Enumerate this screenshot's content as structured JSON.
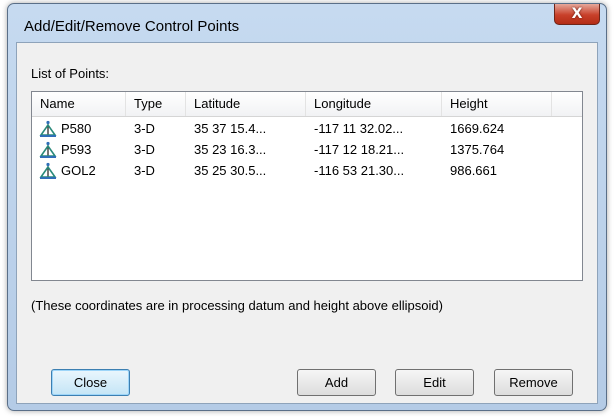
{
  "window": {
    "title": "Add/Edit/Remove Control Points",
    "close_glyph": "X"
  },
  "list": {
    "label": "List of Points:",
    "columns": [
      "Name",
      "Type",
      "Latitude",
      "Longitude",
      "Height"
    ],
    "rows": [
      {
        "name": "P580",
        "type": "3-D",
        "latitude": "35 37 15.4...",
        "longitude": "-117 11 32.02...",
        "height": "1669.624",
        "icon": "control-point-icon"
      },
      {
        "name": "P593",
        "type": "3-D",
        "latitude": "35 23 16.3...",
        "longitude": "-117 12 18.21...",
        "height": "1375.764",
        "icon": "control-point-icon"
      },
      {
        "name": "GOL2",
        "type": "3-D",
        "latitude": "35 25 30.5...",
        "longitude": "-116 53 21.30...",
        "height": "986.661",
        "icon": "control-point-icon"
      }
    ]
  },
  "note": "(These coordinates are in processing datum and height above ellipsoid)",
  "buttons": {
    "close": "Close",
    "add": "Add",
    "edit": "Edit",
    "remove": "Remove"
  },
  "colors": {
    "icon_blue": "#2f6fb8",
    "icon_teal": "#2a8a7a"
  }
}
